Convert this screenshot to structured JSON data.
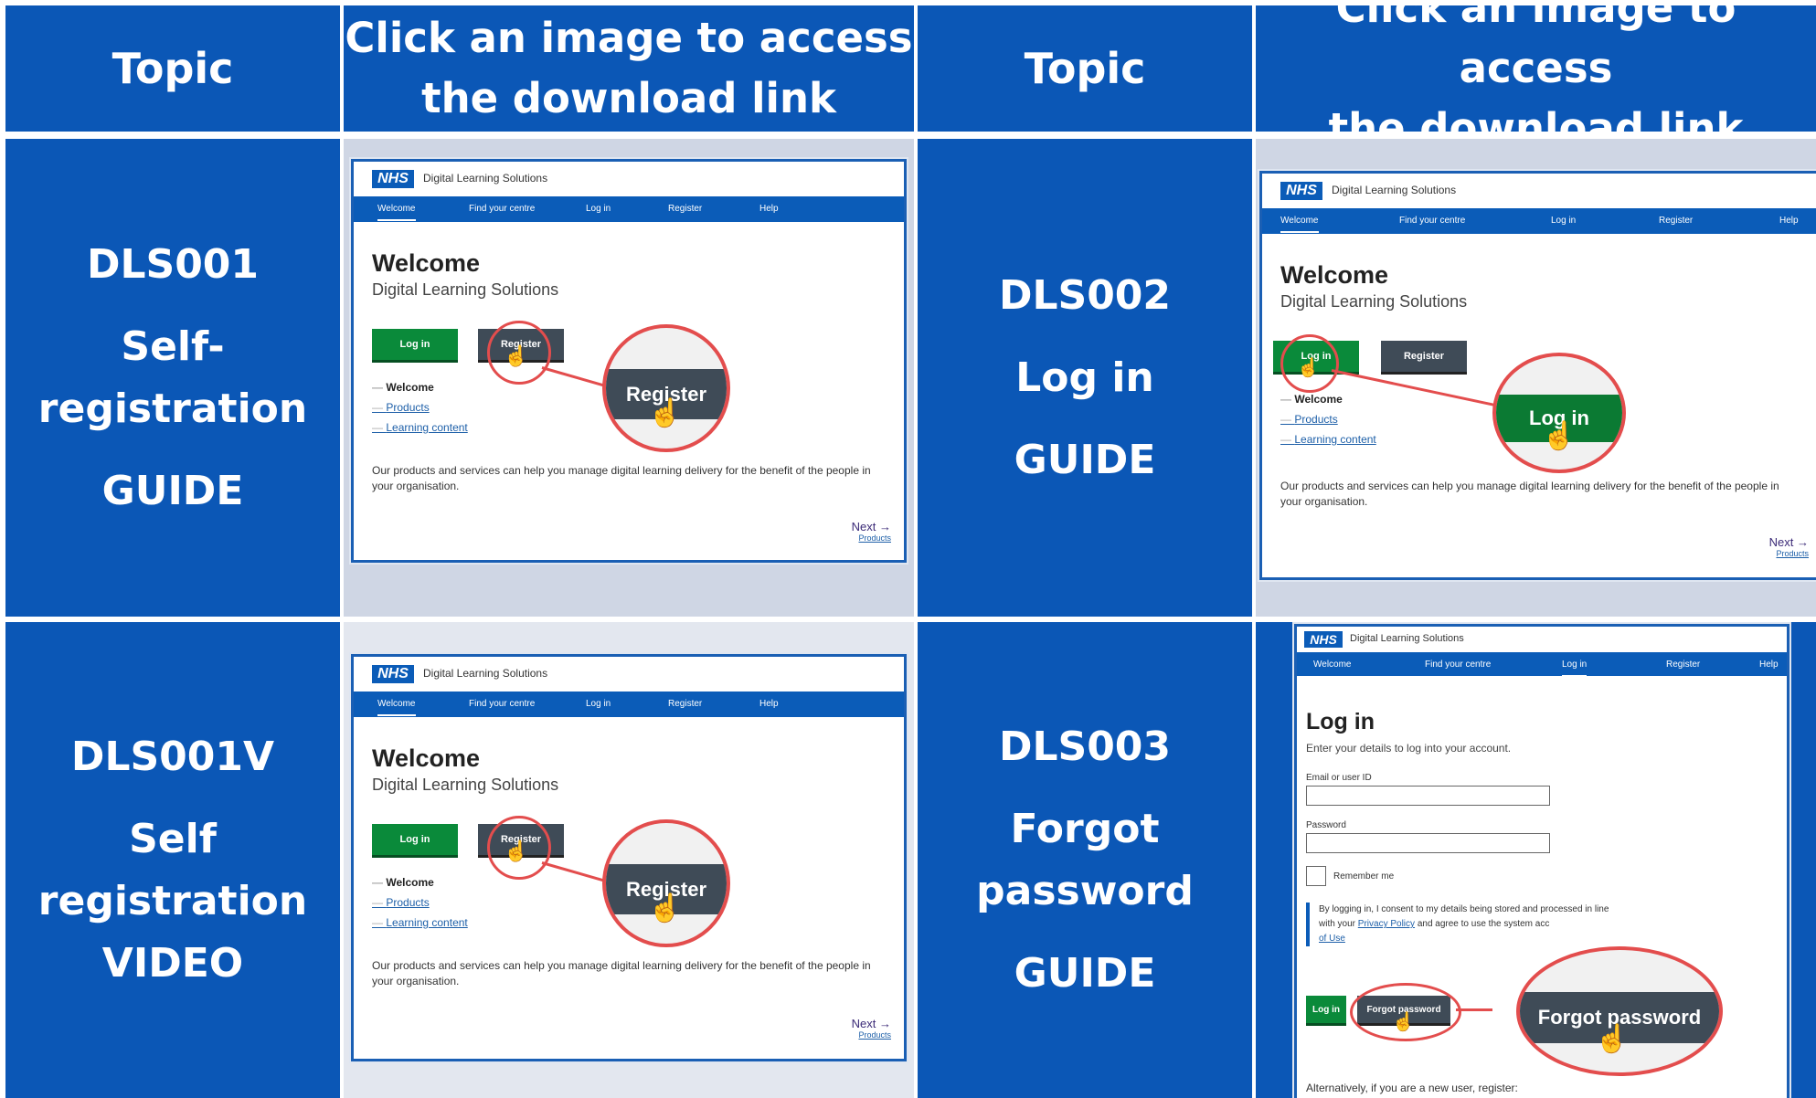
{
  "headers": {
    "topic": "Topic",
    "click_line1": "Click an image to access",
    "click_line2": "the download link"
  },
  "topics": [
    {
      "code": "DLS001",
      "title_line1": "Self-",
      "title_line2": "registration",
      "kind": "GUIDE"
    },
    {
      "code": "DLS002",
      "title_line1": "Log in",
      "title_line2": "",
      "kind": "GUIDE"
    },
    {
      "code": "DLS001V",
      "title_line1": "Self",
      "title_line2": "registration",
      "kind": "VIDEO"
    },
    {
      "code": "DLS003",
      "title_line1": "Forgot",
      "title_line2": "password",
      "kind": "GUIDE"
    }
  ],
  "shot": {
    "logo": "NHS",
    "brand": "Digital Learning Solutions",
    "nav": [
      "Welcome",
      "Find your centre",
      "Log in",
      "Register",
      "Help"
    ],
    "welcome_title": "Welcome",
    "welcome_sub": "Digital Learning Solutions",
    "btn_login": "Log in",
    "btn_register": "Register",
    "list": [
      "Welcome",
      "Products",
      "Learning content"
    ],
    "para": "Our products and services can help you manage digital learning delivery for the benefit of the people in your organisation.",
    "next": "Next →",
    "next_sub": "Products",
    "zoom_register": "Register",
    "zoom_login": "Log in"
  },
  "login_shot": {
    "title": "Log in",
    "sub": "Enter your details to log into your account.",
    "email_label": "Email or user ID",
    "password_label": "Password",
    "remember": "Remember me",
    "consent_a": "By logging in, I consent to my details being stored and processed in line",
    "consent_b": "with your ",
    "privacy": "Privacy Policy",
    "consent_c": " and agree to use the system acc",
    "terms": "of Use",
    "btn_login": "Log in",
    "btn_forgot": "Forgot password",
    "zoom_forgot": "Forgot password",
    "alt": "Alternatively, if you are a new user, register:"
  },
  "colors": {
    "nhs_blue": "#0b57b6",
    "green": "#0a8a3a",
    "grey": "#3f4b57",
    "red": "#e34d4d"
  }
}
